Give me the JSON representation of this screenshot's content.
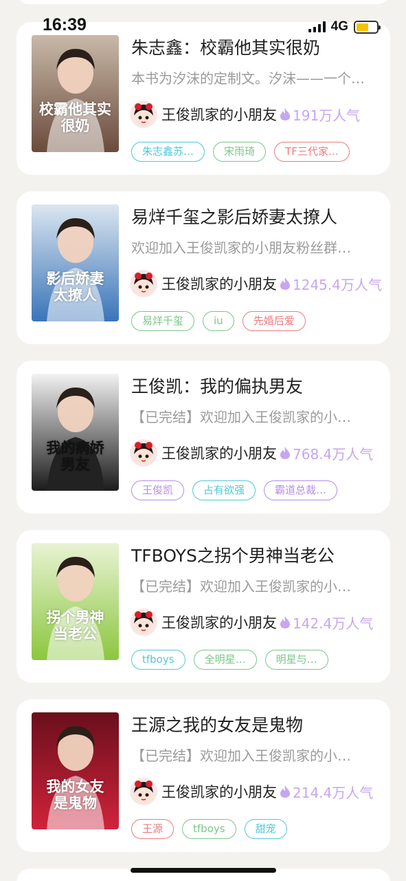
{
  "status_bar": {
    "time": "16:39",
    "network": "4G",
    "battery_level": 0.6
  },
  "books": [
    {
      "title": "朱志鑫：校霸他其实很奶",
      "description": "本书为汐沫的定制文。汐沫——一个…",
      "author": "王俊凯家的小朋友",
      "popularity": "191万人气",
      "cover_text": [
        "校霸他其实",
        "很奶"
      ],
      "cover_colors": [
        "#c9b9a8",
        "#6a4b3c"
      ],
      "tags": [
        {
          "label": "朱志鑫苏…",
          "color": "cyan"
        },
        {
          "label": "宋雨琦",
          "color": "green"
        },
        {
          "label": "TF三代家…",
          "color": "red"
        }
      ]
    },
    {
      "title": "易烊千玺之影后娇妻太撩人",
      "description": "欢迎加入王俊凯家的小朋友粉丝群…",
      "author": "王俊凯家的小朋友",
      "popularity": "1245.4万人气",
      "cover_text": [
        "影后娇妻",
        "太撩人"
      ],
      "cover_colors": [
        "#dbe6f0",
        "#3a74b8"
      ],
      "tags": [
        {
          "label": "易烊千玺",
          "color": "green"
        },
        {
          "label": "iu",
          "color": "green"
        },
        {
          "label": "先婚后爱",
          "color": "red"
        }
      ]
    },
    {
      "title": "王俊凯：我的偏执男友",
      "description": "【已完结】欢迎加入王俊凯家的小…",
      "author": "王俊凯家的小朋友",
      "popularity": "768.4万人气",
      "cover_text": [
        "我的病娇",
        "男友"
      ],
      "cover_colors": [
        "#f2f2f2",
        "#1b1b1b"
      ],
      "tags": [
        {
          "label": "王俊凯",
          "color": "purple"
        },
        {
          "label": "占有欲强",
          "color": "cyan"
        },
        {
          "label": "霸道总裁…",
          "color": "purple"
        }
      ]
    },
    {
      "title": "TFBOYS之拐个男神当老公",
      "description": "【已完结】欢迎加入王俊凯家的小…",
      "author": "王俊凯家的小朋友",
      "popularity": "142.4万人气",
      "cover_text": [
        "拐个男神",
        "当老公"
      ],
      "cover_colors": [
        "#e8f3d4",
        "#8cc63f"
      ],
      "tags": [
        {
          "label": "tfboys",
          "color": "cyan"
        },
        {
          "label": "全明星…",
          "color": "green"
        },
        {
          "label": "明星与…",
          "color": "green"
        }
      ]
    },
    {
      "title": "王源之我的女友是鬼物",
      "description": "【已完结】欢迎加入王俊凯家的小…",
      "author": "王俊凯家的小朋友",
      "popularity": "214.4万人气",
      "cover_text": [
        "我的女友",
        "是鬼物"
      ],
      "cover_colors": [
        "#6a0f1c",
        "#d0233b"
      ],
      "tags": [
        {
          "label": "王源",
          "color": "red"
        },
        {
          "label": "tfboys",
          "color": "green"
        },
        {
          "label": "甜宠",
          "color": "cyan"
        }
      ]
    }
  ]
}
